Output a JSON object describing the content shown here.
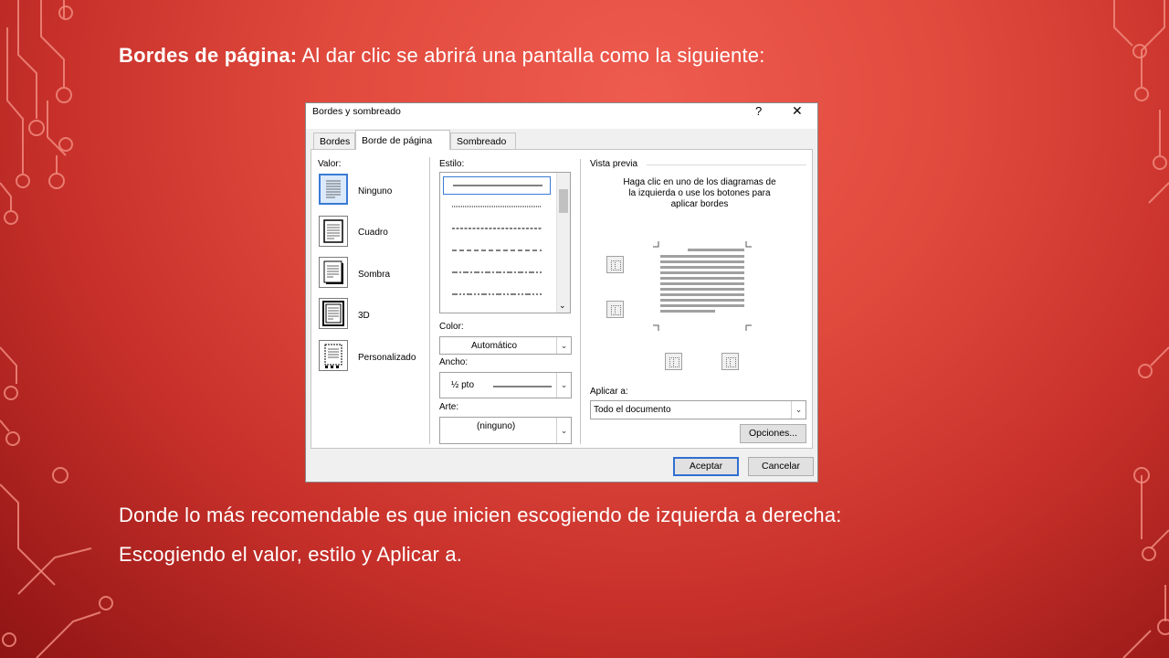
{
  "slide": {
    "heading_bold": "Bordes de página:",
    "heading_rest": " Al dar clic se abrirá una pantalla como la siguiente:",
    "body_line1": "Donde lo más recomendable es que inicien escogiendo de izquierda a derecha:",
    "body_line2": "Escogiendo el valor, estilo y Aplicar a."
  },
  "dialog": {
    "title": "Bordes y sombreado",
    "help": "?",
    "close": "✕",
    "tabs": [
      {
        "label": "Bordes",
        "active": false
      },
      {
        "label": "Borde de página",
        "active": true
      },
      {
        "label": "Sombreado",
        "active": false
      }
    ],
    "valor": {
      "label": "Valor:",
      "items": [
        {
          "label": "Ninguno",
          "icon": "page-none-icon",
          "selected": true
        },
        {
          "label": "Cuadro",
          "icon": "page-box-icon",
          "selected": false
        },
        {
          "label": "Sombra",
          "icon": "page-shadow-icon",
          "selected": false
        },
        {
          "label": "3D",
          "icon": "page-3d-icon",
          "selected": false
        },
        {
          "label": "Personalizado",
          "icon": "page-custom-icon",
          "selected": false
        }
      ]
    },
    "estilo": {
      "label": "Estilo:",
      "items": [
        "solid",
        "dotted",
        "dashed",
        "long-dashed",
        "dash-dot",
        "dash-dot-dot"
      ]
    },
    "color": {
      "label": "Color:",
      "value": "Automático"
    },
    "ancho": {
      "label": "Ancho:",
      "value": "½ pto"
    },
    "arte": {
      "label": "Arte:",
      "value": "(ninguno)"
    },
    "vista_previa": {
      "label": "Vista previa",
      "hint": "Haga clic en uno de los diagramas de la izquierda o use los botones para aplicar bordes"
    },
    "aplicar": {
      "label": "Aplicar a:",
      "value": "Todo el documento"
    },
    "buttons": {
      "opciones": "Opciones...",
      "aceptar": "Aceptar",
      "cancelar": "Cancelar"
    },
    "accent_color": "#3a7bd5"
  }
}
